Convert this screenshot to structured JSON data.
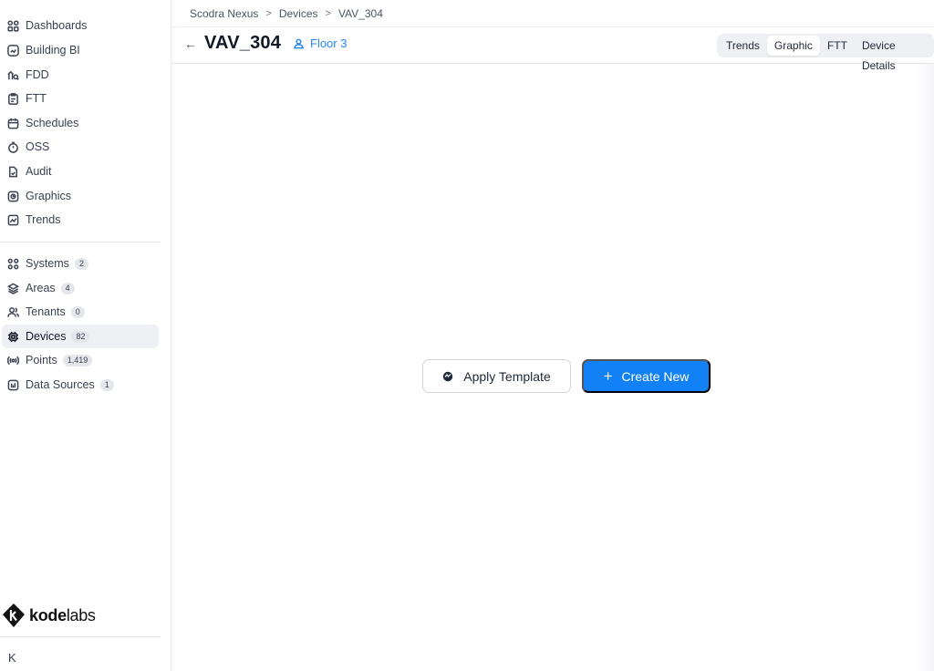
{
  "breadcrumb": {
    "items": [
      "Scodra Nexus",
      "Devices",
      "VAV_304"
    ]
  },
  "header": {
    "back_icon": "arrow-left-icon",
    "title": "VAV_304",
    "location": "Floor 3"
  },
  "tabs": [
    "Trends",
    "Graphic",
    "FTT",
    "Device Details"
  ],
  "active_tab": "Graphic",
  "sidebar": {
    "primary": [
      {
        "label": "Dashboards",
        "icon": "grid-icon"
      },
      {
        "label": "Building BI",
        "icon": "chart-card-icon"
      },
      {
        "label": "FDD",
        "icon": "fdd-icon"
      },
      {
        "label": "FTT",
        "icon": "clipboard-icon"
      },
      {
        "label": "Schedules",
        "icon": "calendar-icon"
      },
      {
        "label": "OSS",
        "icon": "timer-icon"
      },
      {
        "label": "Audit",
        "icon": "file-check-icon"
      },
      {
        "label": "Graphics",
        "icon": "graphics-icon"
      },
      {
        "label": "Trends",
        "icon": "trend-icon"
      }
    ],
    "secondary": [
      {
        "label": "Systems",
        "count": "2",
        "icon": "systems-icon"
      },
      {
        "label": "Areas",
        "count": "4",
        "icon": "layers-icon"
      },
      {
        "label": "Tenants",
        "count": "0",
        "icon": "users-icon"
      },
      {
        "label": "Devices",
        "count": "82",
        "icon": "chip-icon"
      },
      {
        "label": "Points",
        "count": "1,419",
        "icon": "broadcast-icon"
      },
      {
        "label": "Data Sources",
        "count": "1",
        "icon": "database-icon"
      }
    ],
    "active": "Devices",
    "collapse_label": "K"
  },
  "logo": {
    "bold": "kode",
    "light": "labs"
  },
  "actions": {
    "apply_template": "Apply Template",
    "create_new": "Create New",
    "create_icon": "plus-icon"
  },
  "colors": {
    "accent": "#1281f5",
    "link": "#2b87f0",
    "active_bg": "#eef0f3"
  }
}
